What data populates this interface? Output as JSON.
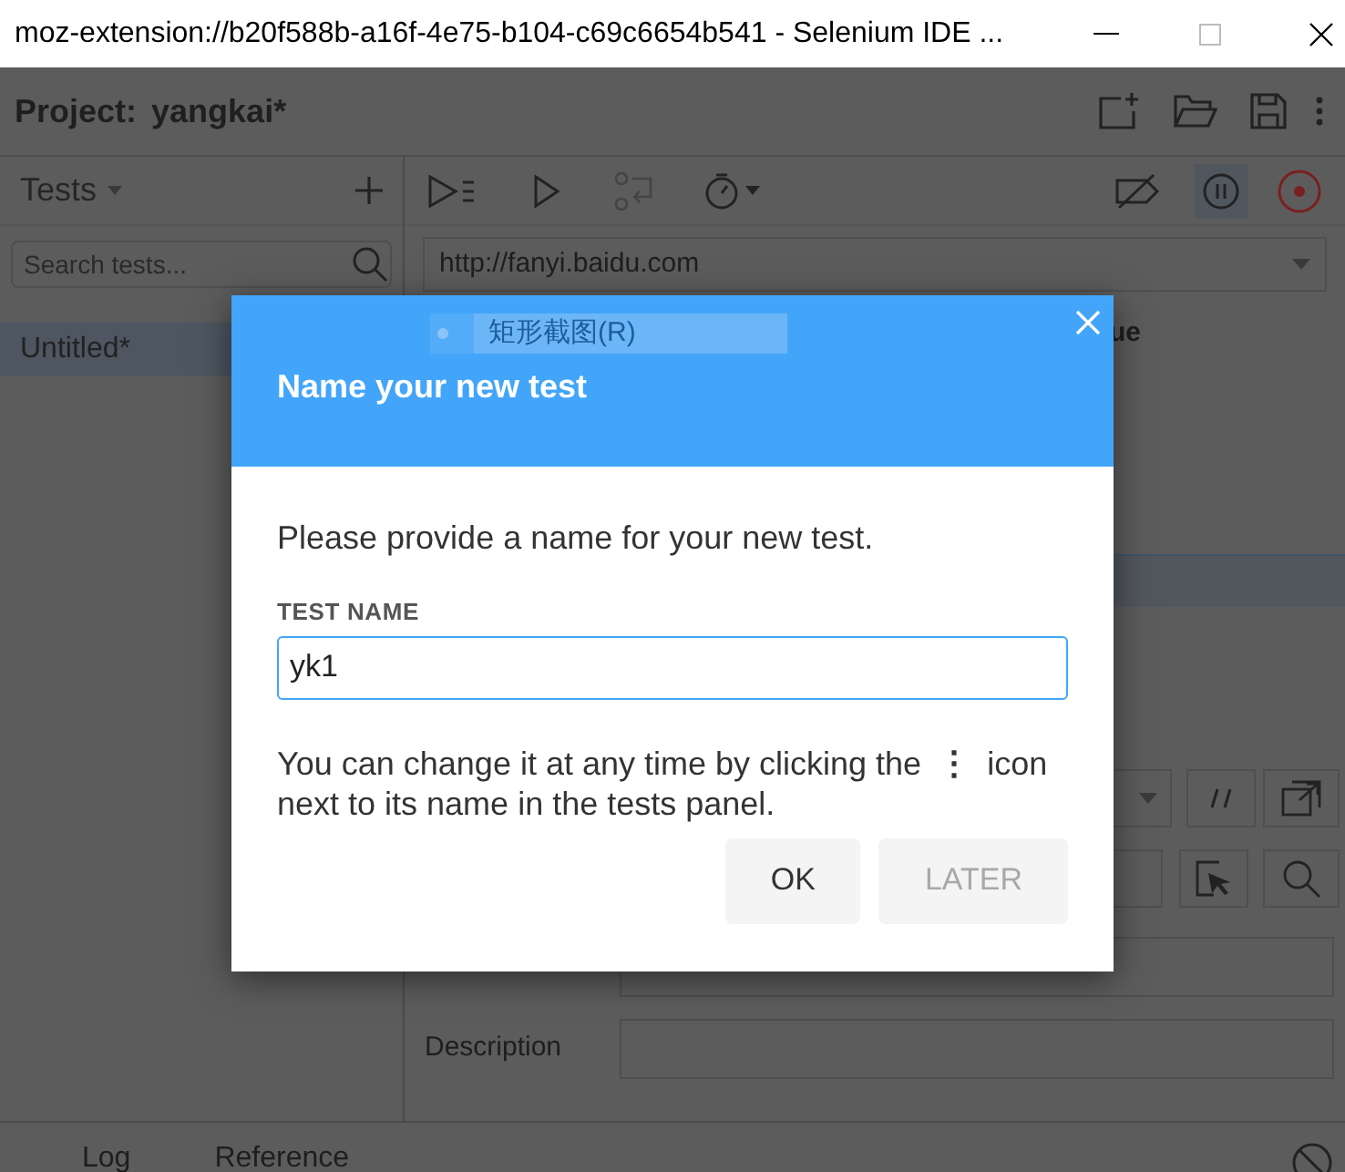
{
  "window": {
    "title": "moz-extension://b20f588b-a16f-4e75-b104-c69c6654b541 - Selenium IDE ..."
  },
  "header": {
    "label": "Project:",
    "project": "yangkai*"
  },
  "tests_panel": {
    "title": "Tests",
    "search": {
      "placeholder": "Search tests..."
    },
    "items": [
      {
        "name": "Untitled*",
        "selected": true
      }
    ]
  },
  "url": {
    "value": "http://fanyi.baidu.com"
  },
  "table": {
    "column_3": "ue"
  },
  "context_menu": {
    "items": [
      {
        "label": "矩形截图(R)"
      }
    ]
  },
  "editor": {
    "description_label": "Description"
  },
  "bottom_tabs": [
    {
      "label": "Log"
    },
    {
      "label": "Reference"
    }
  ],
  "dialog": {
    "title": "Name your new test",
    "message": "Please provide a name for your new test.",
    "field_label": "TEST NAME",
    "field_value": "yk1",
    "hint_before": "You can change it at any time by clicking the",
    "hint_icon": "⋮",
    "hint_after": "icon next to its name in the tests panel.",
    "buttons": [
      {
        "label": "OK",
        "disabled": false
      },
      {
        "label": "LATER",
        "disabled": true
      }
    ]
  }
}
